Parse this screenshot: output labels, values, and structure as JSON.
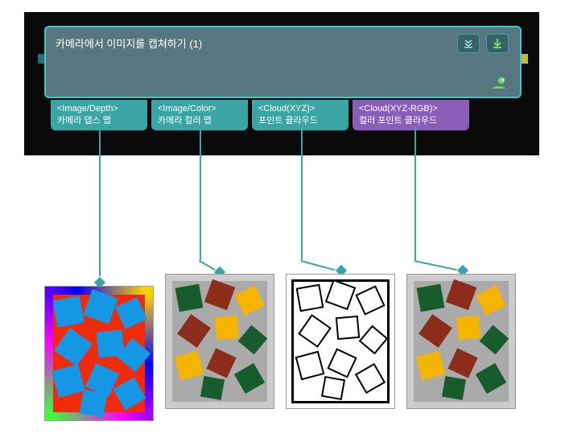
{
  "main_block": {
    "title": "카메라에서 이미지를 캡쳐하기 (1)"
  },
  "outputs": [
    {
      "type": "<Image/Depth>",
      "label": "카메라 뎁스 맵"
    },
    {
      "type": "<Image/Color>",
      "label": "카메라 컬러 맵"
    },
    {
      "type": "<Cloud(XYZ)>",
      "label": "포인트 클라우드"
    },
    {
      "type": "<Cloud(XYZ-RGB)>",
      "label": "컬러 포인트 클라우드"
    }
  ]
}
